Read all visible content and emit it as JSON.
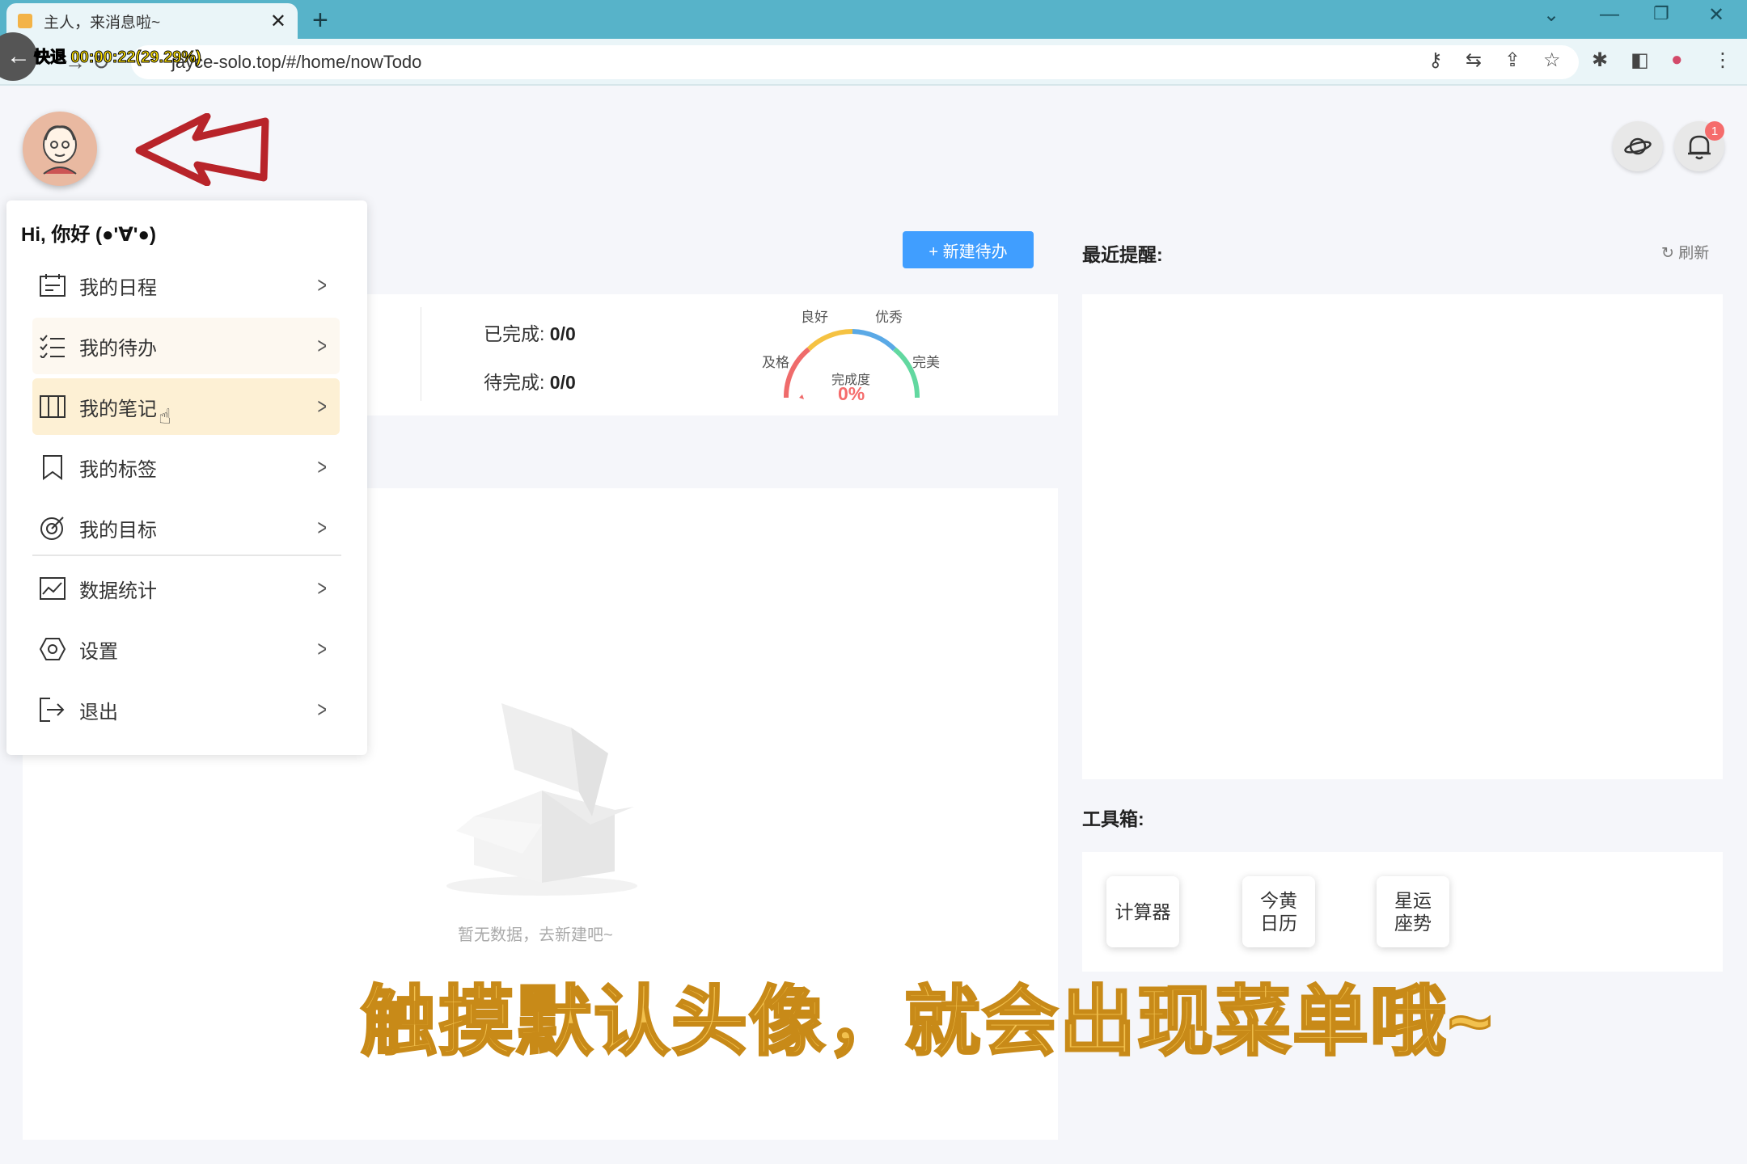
{
  "browser": {
    "tab_title": "主人，来消息啦~",
    "url": "jayce-solo.top/#/home/nowTodo",
    "overlay": "快退 00:00:22(29.29%)"
  },
  "header": {
    "notification_count": "1",
    "new_todo_label": "+ 新建待办"
  },
  "stats": {
    "done_label": "已完成:",
    "done_value": "0/0",
    "pending_label": "待完成:",
    "pending_value": "0/0"
  },
  "gauge": {
    "title": "完成度",
    "value": "0%",
    "labels": [
      "及格",
      "良好",
      "优秀",
      "完美"
    ]
  },
  "empty": {
    "text": "暂无数据，去新建吧~"
  },
  "reminders": {
    "title": "最近提醒:",
    "refresh_label": "刷新"
  },
  "toolbox": {
    "title": "工具箱:",
    "items": [
      "计算器",
      "今黄日历",
      "星运座势"
    ],
    "calendar_l1": "今黄",
    "calendar_l2": "日历",
    "star_l1": "星运",
    "star_l2": "座势"
  },
  "menu": {
    "greeting": "Hi, 你好 (●'∀'●)",
    "items": [
      "我的日程",
      "我的待办",
      "我的笔记",
      "我的标签",
      "我的目标",
      "数据统计",
      "设置",
      "退出"
    ]
  },
  "caption": "触摸默认头像，就会出现菜单哦~"
}
